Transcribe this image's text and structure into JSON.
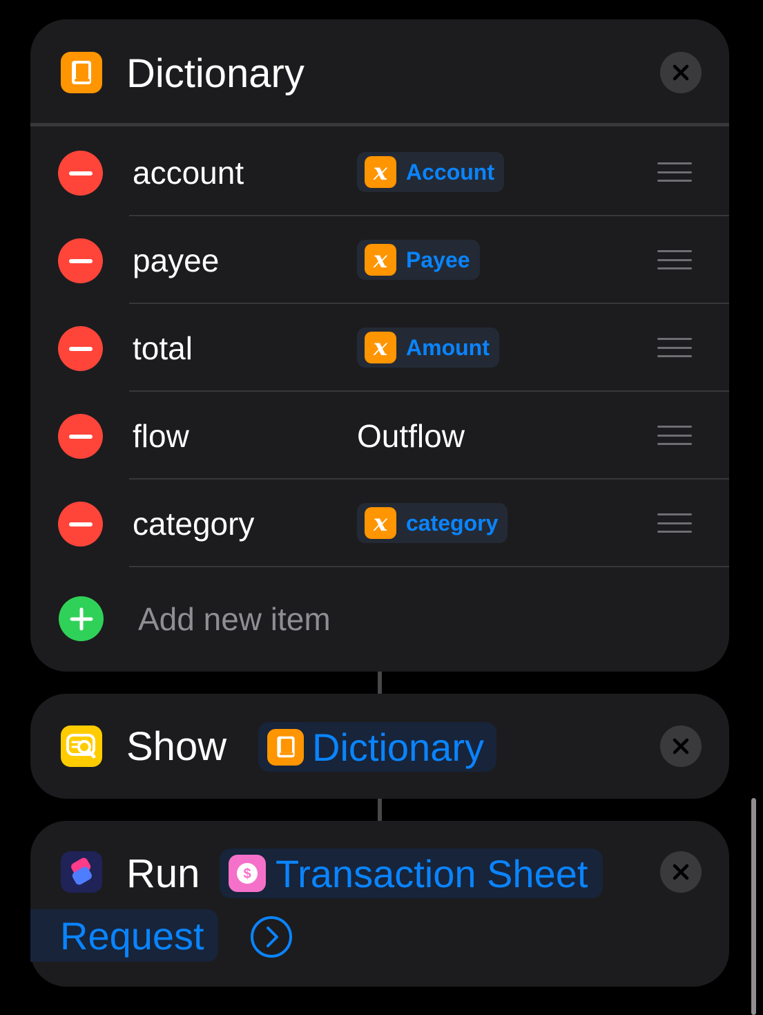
{
  "dictionary_action": {
    "title": "Dictionary",
    "items": [
      {
        "key": "account",
        "value": "Account",
        "value_type": "variable"
      },
      {
        "key": "payee",
        "value": "Payee",
        "value_type": "variable"
      },
      {
        "key": "total",
        "value": "Amount",
        "value_type": "variable"
      },
      {
        "key": "flow",
        "value": "Outflow",
        "value_type": "text"
      },
      {
        "key": "category",
        "value": "category",
        "value_type": "variable"
      }
    ],
    "add_item_label": "Add new item"
  },
  "show_action": {
    "verb": "Show",
    "parameter": "Dictionary"
  },
  "run_action": {
    "verb": "Run",
    "shortcut_name": "Transaction Sheet",
    "parameter": "Request"
  },
  "colors": {
    "background": "#000000",
    "card": "#1c1c1e",
    "accent_blue": "#0a84ff",
    "delete_red": "#ff453a",
    "add_green": "#30d158",
    "variable_orange": "#ff9500",
    "show_yellow": "#ffcc00"
  },
  "icons": {
    "dictionary": "book-icon",
    "variable": "variable-x-icon",
    "show": "quicklook-icon",
    "run": "shortcuts-icon",
    "transaction_sheet": "dollar-coin-icon",
    "close": "close-x-icon",
    "delete": "minus-circle-icon",
    "add": "plus-circle-icon",
    "reorder": "drag-handle-icon",
    "expand": "chevron-right-circle-icon"
  }
}
